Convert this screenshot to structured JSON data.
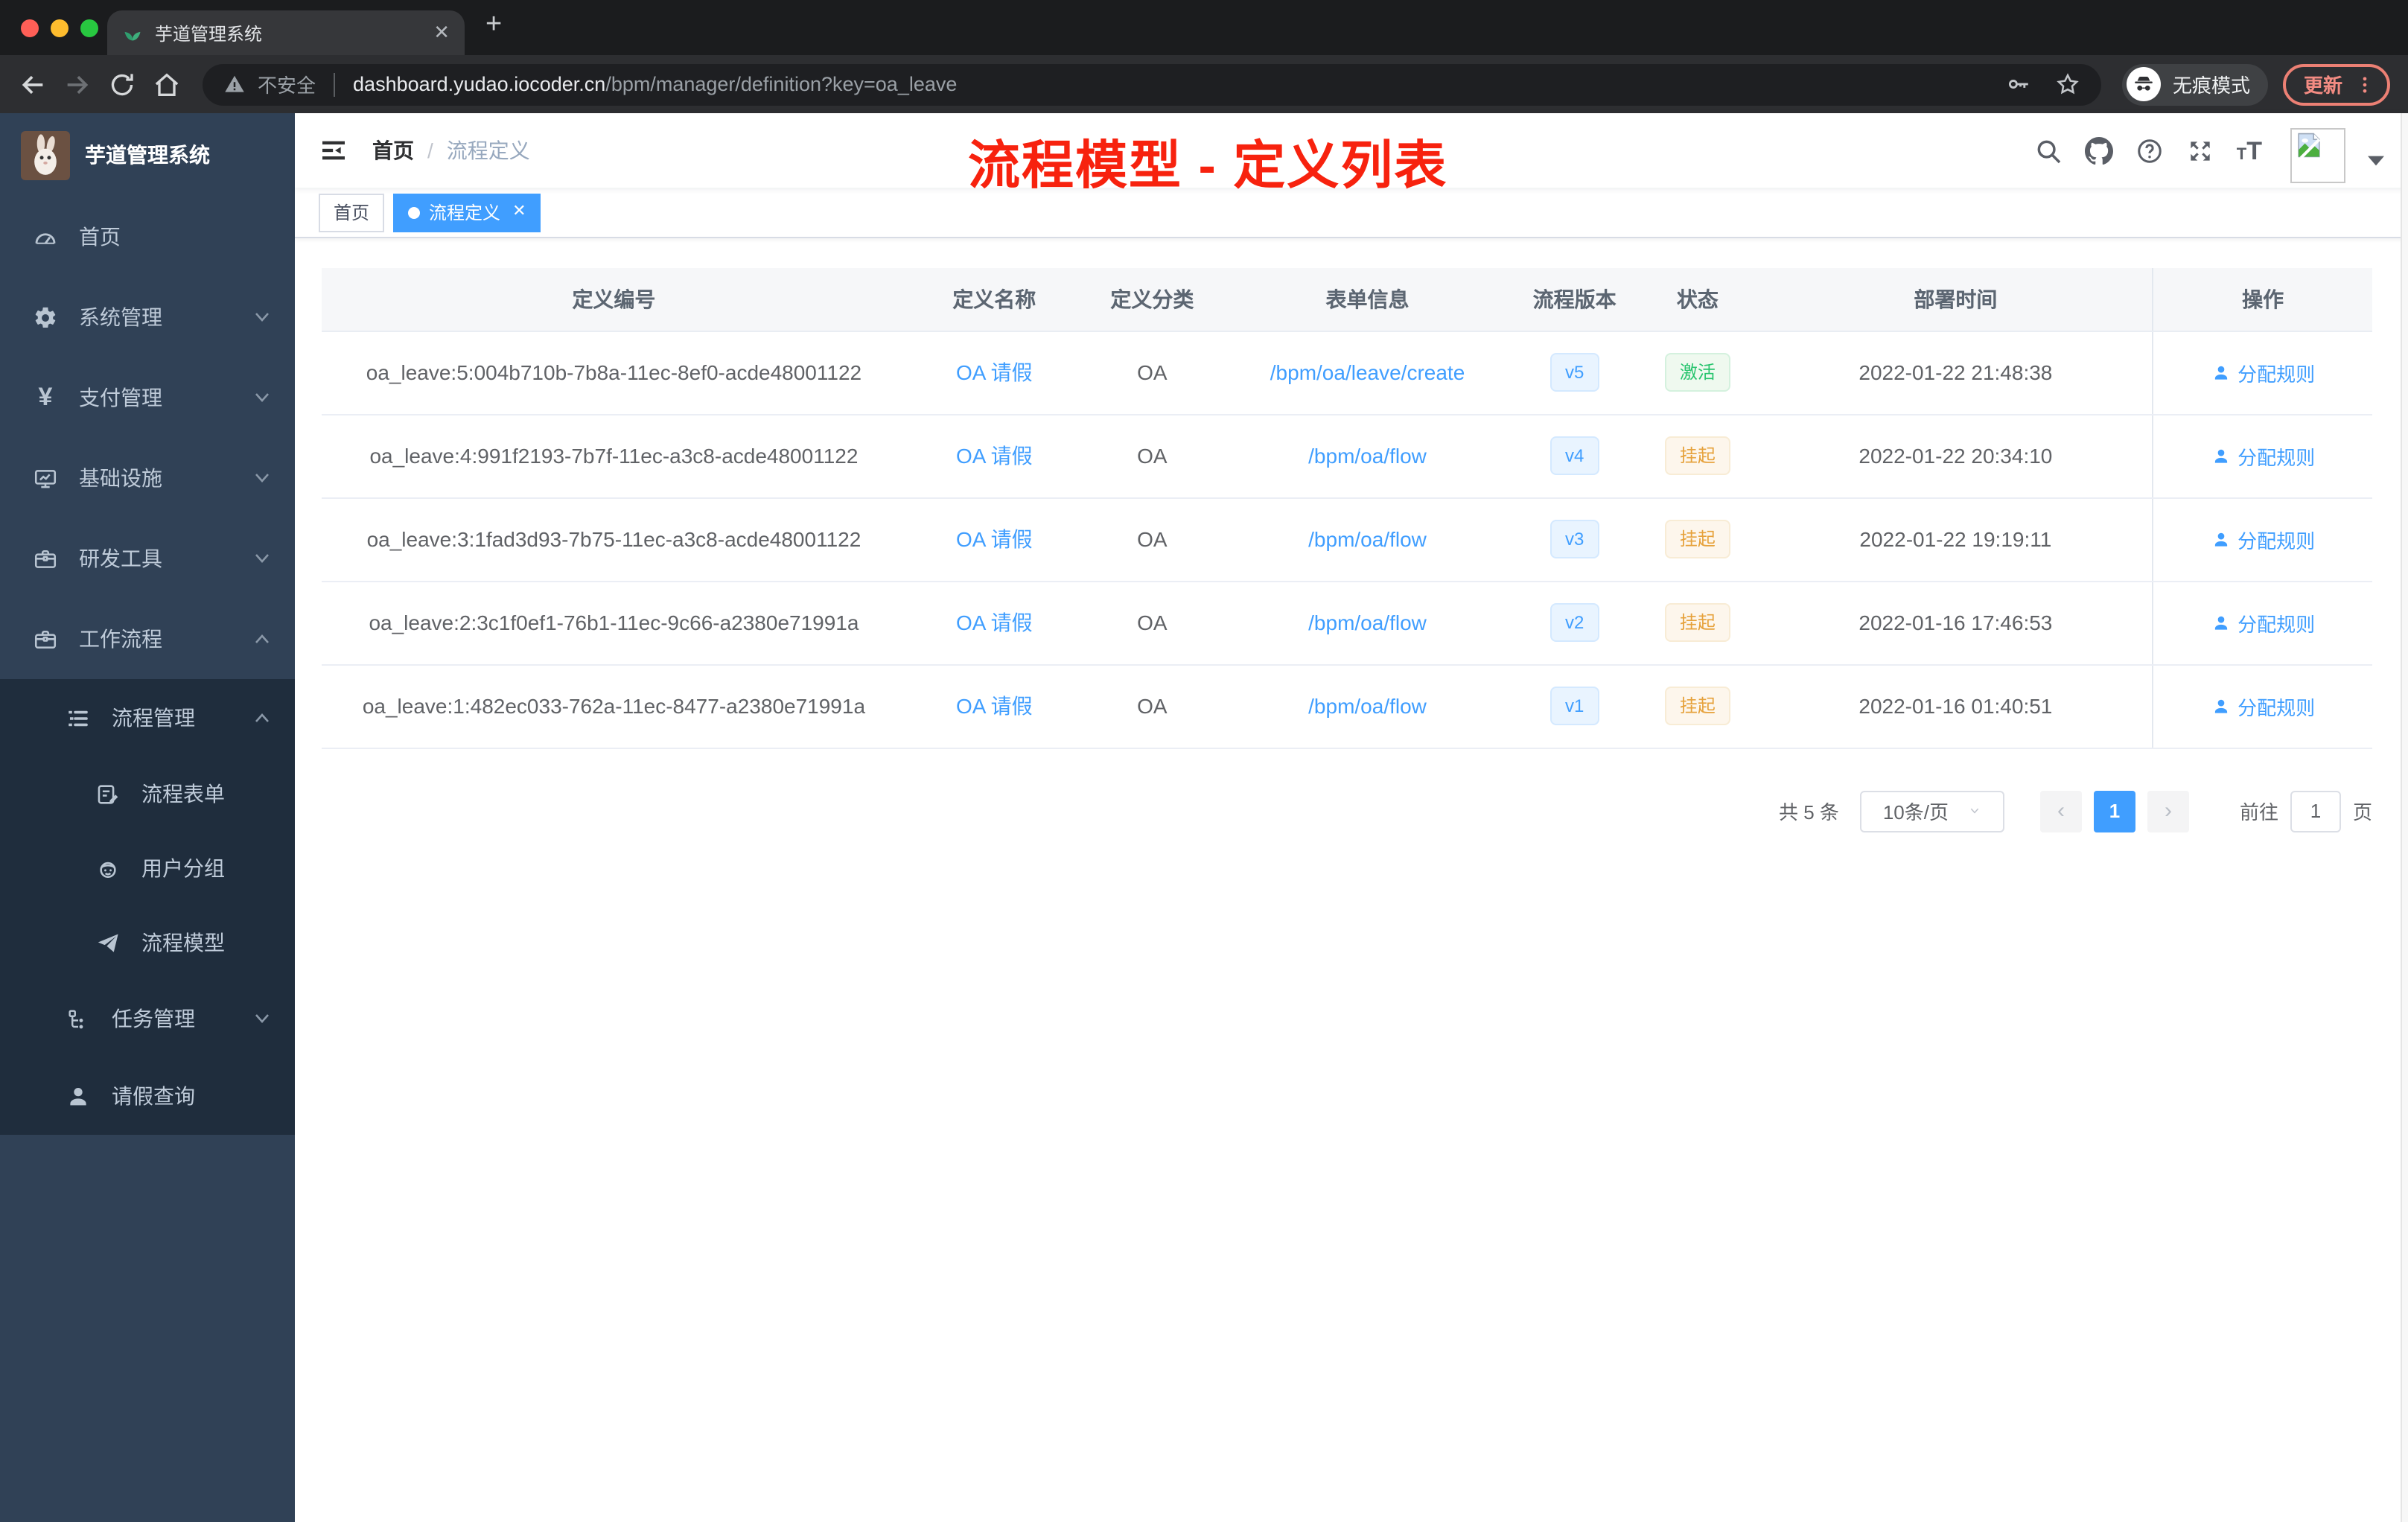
{
  "colors": {
    "accent_blue": "#409eff",
    "annotation_red": "#f7220e",
    "sidebar_bg": "#304156",
    "sidebar_submenu_bg": "#1f2d3d",
    "tag_success_text": "#27c46d",
    "tag_warning_text": "#e6a23c"
  },
  "browser": {
    "tab_title": "芋道管理系统",
    "security_label": "不安全",
    "url_host": "dashboard.yudao.iocoder.cn",
    "url_path": "/bpm/manager/definition?key=oa_leave",
    "incognito_label": "无痕模式",
    "update_label": "更新"
  },
  "sidebar": {
    "logo_title": "芋道管理系统",
    "items": [
      {
        "key": "home",
        "icon": "dashboard",
        "label": "首页",
        "depth": 0,
        "chevron": null,
        "dark": false
      },
      {
        "key": "system",
        "icon": "gear",
        "label": "系统管理",
        "depth": 0,
        "chevron": "down",
        "dark": false
      },
      {
        "key": "payment",
        "icon": "yen",
        "label": "支付管理",
        "depth": 0,
        "chevron": "down",
        "dark": false
      },
      {
        "key": "infra",
        "icon": "monitor",
        "label": "基础设施",
        "depth": 0,
        "chevron": "down",
        "dark": false
      },
      {
        "key": "devtools",
        "icon": "toolbox",
        "label": "研发工具",
        "depth": 0,
        "chevron": "down",
        "dark": false
      },
      {
        "key": "workflow",
        "icon": "toolbox",
        "label": "工作流程",
        "depth": 0,
        "chevron": "up",
        "dark": false
      },
      {
        "key": "process-manage",
        "icon": "list",
        "label": "流程管理",
        "depth": 1,
        "chevron": "up",
        "dark": true
      },
      {
        "key": "process-form",
        "icon": "form",
        "label": "流程表单",
        "depth": 2,
        "chevron": null,
        "dark": true
      },
      {
        "key": "user-group",
        "icon": "robot",
        "label": "用户分组",
        "depth": 2,
        "chevron": null,
        "dark": true
      },
      {
        "key": "process-model",
        "icon": "paper-plane",
        "label": "流程模型",
        "depth": 2,
        "chevron": null,
        "dark": true
      },
      {
        "key": "task-manage",
        "icon": "task",
        "label": "任务管理",
        "depth": 1,
        "chevron": "down",
        "dark": true
      },
      {
        "key": "leave-query",
        "icon": "user",
        "label": "请假查询",
        "depth": 1,
        "chevron": null,
        "dark": true
      }
    ]
  },
  "navbar": {
    "breadcrumb_home": "首页",
    "breadcrumb_sep": "/",
    "breadcrumb_current": "流程定义",
    "annotation": "流程模型 - 定义列表"
  },
  "tags_view": {
    "tags": [
      {
        "label": "首页",
        "active": false,
        "closable": false
      },
      {
        "label": "流程定义",
        "active": true,
        "closable": true
      }
    ]
  },
  "table": {
    "columns": [
      "定义编号",
      "定义名称",
      "定义分类",
      "表单信息",
      "流程版本",
      "状态",
      "部署时间",
      "操作"
    ],
    "action_label": "分配规则",
    "rows": [
      {
        "id": "oa_leave:5:004b710b-7b8a-11ec-8ef0-acde48001122",
        "name": "OA 请假",
        "category": "OA",
        "form": "/bpm/oa/leave/create",
        "version": "v5",
        "status": "激活",
        "status_type": "success",
        "deploy_time": "2022-01-22 21:48:38",
        "action": "分配规则"
      },
      {
        "id": "oa_leave:4:991f2193-7b7f-11ec-a3c8-acde48001122",
        "name": "OA 请假",
        "category": "OA",
        "form": "/bpm/oa/flow",
        "version": "v4",
        "status": "挂起",
        "status_type": "warning",
        "deploy_time": "2022-01-22 20:34:10",
        "action": "分配规则"
      },
      {
        "id": "oa_leave:3:1fad3d93-7b75-11ec-a3c8-acde48001122",
        "name": "OA 请假",
        "category": "OA",
        "form": "/bpm/oa/flow",
        "version": "v3",
        "status": "挂起",
        "status_type": "warning",
        "deploy_time": "2022-01-22 19:19:11",
        "action": "分配规则"
      },
      {
        "id": "oa_leave:2:3c1f0ef1-76b1-11ec-9c66-a2380e71991a",
        "name": "OA 请假",
        "category": "OA",
        "form": "/bpm/oa/flow",
        "version": "v2",
        "status": "挂起",
        "status_type": "warning",
        "deploy_time": "2022-01-16 17:46:53",
        "action": "分配规则"
      },
      {
        "id": "oa_leave:1:482ec033-762a-11ec-8477-a2380e71991a",
        "name": "OA 请假",
        "category": "OA",
        "form": "/bpm/oa/flow",
        "version": "v1",
        "status": "挂起",
        "status_type": "warning",
        "deploy_time": "2022-01-16 01:40:51",
        "action": "分配规则"
      }
    ]
  },
  "pagination": {
    "total_text": "共 5 条",
    "page_size": "10条/页",
    "current_page": "1",
    "goto_label": "前往",
    "page_suffix": "页"
  }
}
